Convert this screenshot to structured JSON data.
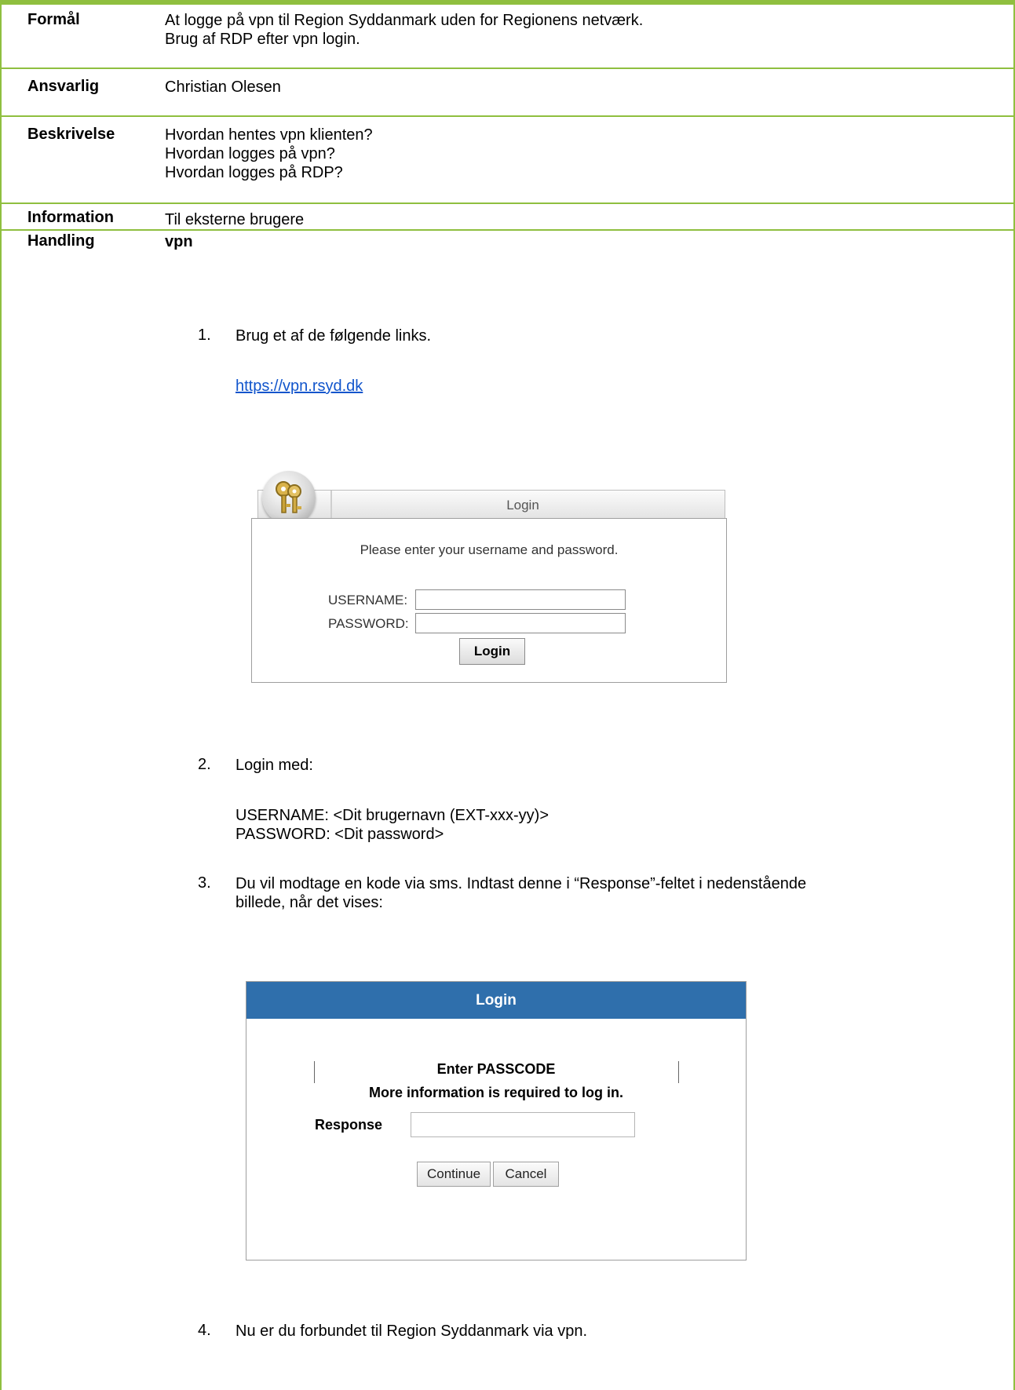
{
  "table": {
    "formaal_label": "Formål",
    "formaal_line1": "At logge på vpn til Region Syddanmark uden for Regionens netværk.",
    "formaal_line2": "Brug af RDP efter vpn login.",
    "ansvarlig_label": "Ansvarlig",
    "ansvarlig_value": "Christian Olesen",
    "beskrivelse_label": "Beskrivelse",
    "beskrivelse_line1": "Hvordan hentes vpn klienten?",
    "beskrivelse_line2": "Hvordan logges på vpn?",
    "beskrivelse_line3": "Hvordan logges på RDP?",
    "information_label": "Information",
    "information_value": "Til eksterne brugere",
    "handling_label": "Handling",
    "handling_value": "vpn"
  },
  "steps": {
    "s1_num": "1.",
    "s1_text": "Brug et af de følgende links.",
    "s1_link": "https://vpn.rsyd.dk",
    "s2_num": "2.",
    "s2_text": "Login med:",
    "s2_user": "USERNAME:  <Dit brugernavn (EXT-xxx-yy)>",
    "s2_pass": "PASSWORD: <Dit password>",
    "s3_num": "3.",
    "s3_line1": "Du vil modtage en kode via sms. Indtast denne i “Response”-feltet i nedenstående",
    "s3_line2": "billede, når det vises:",
    "s4_num": "4.",
    "s4_text": "Nu er du forbundet til Region Syddanmark via vpn."
  },
  "login_panel_1": {
    "title": "Login",
    "message": "Please enter your username and password.",
    "username_label": "USERNAME:",
    "password_label": "PASSWORD:",
    "button": "Login"
  },
  "login_panel_2": {
    "title": "Login",
    "heading": "Enter PASSCODE",
    "subheading": "More information is required to log in.",
    "response_label": "Response",
    "continue_button": "Continue",
    "cancel_button": "Cancel"
  },
  "colors": {
    "border": "#8fbf3f",
    "header_blue": "#2f6fac",
    "link": "#1155cc"
  }
}
